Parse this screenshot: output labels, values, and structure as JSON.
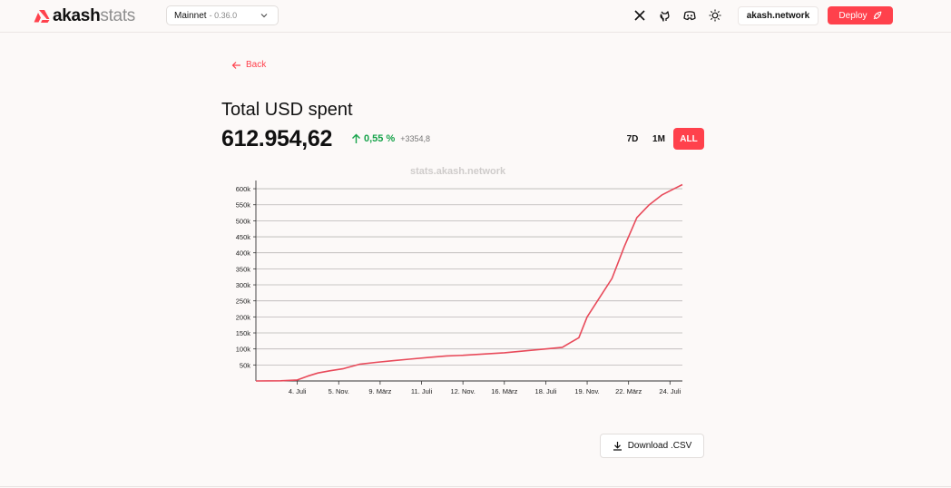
{
  "brand": {
    "name_bold": "akash",
    "name_light": "stats",
    "accent": "#ff414c"
  },
  "header": {
    "network": "Mainnet",
    "version": "0.36.0",
    "icons": [
      "x-icon",
      "github-icon",
      "discord-icon",
      "theme-toggle-icon"
    ],
    "link_label": "akash.network",
    "deploy_label": "Deploy"
  },
  "nav": {
    "back_label": "Back"
  },
  "metric": {
    "title": "Total USD spent",
    "value": "612.954,62",
    "change_pct": "0,55 %",
    "change_abs": "+3354,8",
    "change_color": "#16a34a"
  },
  "ranges": {
    "r7d": "7D",
    "r1m": "1M",
    "rall": "ALL",
    "selected": "ALL"
  },
  "watermark": "stats.akash.network",
  "download_label": "Download .CSV",
  "chart_data": {
    "type": "line",
    "line_color": "#e84a5a",
    "grid": true,
    "y_ticks": [
      50000,
      100000,
      150000,
      200000,
      250000,
      300000,
      350000,
      400000,
      450000,
      500000,
      550000,
      600000
    ],
    "y_tick_labels": [
      "50k",
      "100k",
      "150k",
      "200k",
      "250k",
      "300k",
      "350k",
      "400k",
      "450k",
      "500k",
      "550k",
      "600k"
    ],
    "ylim": [
      0,
      620000
    ],
    "x_tick_labels": [
      "4. Juli",
      "5. Nov.",
      "9. März",
      "11. Juli",
      "12. Nov.",
      "16. März",
      "18. Juli",
      "19. Nov.",
      "22. März",
      "24. Juli"
    ],
    "xlim": [
      0,
      10.3
    ],
    "series": [
      {
        "x": [
          0,
          0.6,
          1.0,
          1.25,
          1.5,
          1.8,
          2.1,
          2.5,
          2.9,
          3.3,
          3.7,
          4.2,
          4.6,
          5.0,
          5.5,
          6.0,
          6.5,
          7.0,
          7.4,
          7.6,
          7.8,
          8.0,
          8.3,
          8.6,
          8.9,
          9.2,
          9.5,
          9.8,
          10.1,
          10.3
        ],
        "y": [
          0,
          500,
          3000,
          15000,
          25000,
          32000,
          38000,
          52000,
          58000,
          63000,
          68000,
          74000,
          78000,
          80000,
          84000,
          88000,
          94000,
          100000,
          105000,
          120000,
          135000,
          200000,
          260000,
          320000,
          420000,
          510000,
          550000,
          580000,
          600000,
          612954
        ]
      }
    ]
  }
}
